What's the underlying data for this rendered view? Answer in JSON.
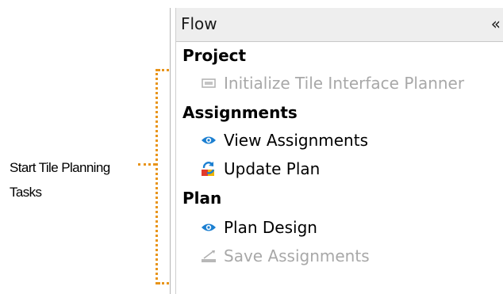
{
  "callout": {
    "line1": "Start Tile Planning",
    "line2": "Tasks",
    "color": "#e8941a"
  },
  "panel": {
    "title": "Flow",
    "collapse_label": "«",
    "sections": {
      "project": {
        "title": "Project",
        "items": [
          {
            "label": "Initialize Tile Interface Planner",
            "icon": "initialize-icon",
            "enabled": false
          }
        ]
      },
      "assignments": {
        "title": "Assignments",
        "items": [
          {
            "label": "View Assignments",
            "icon": "eye-icon",
            "enabled": true
          },
          {
            "label": "Update Plan",
            "icon": "update-plan-icon",
            "enabled": true
          }
        ]
      },
      "plan": {
        "title": "Plan",
        "items": [
          {
            "label": "Plan Design",
            "icon": "eye-icon",
            "enabled": true
          },
          {
            "label": "Save Assignments",
            "icon": "save-icon",
            "enabled": false
          }
        ]
      }
    }
  }
}
